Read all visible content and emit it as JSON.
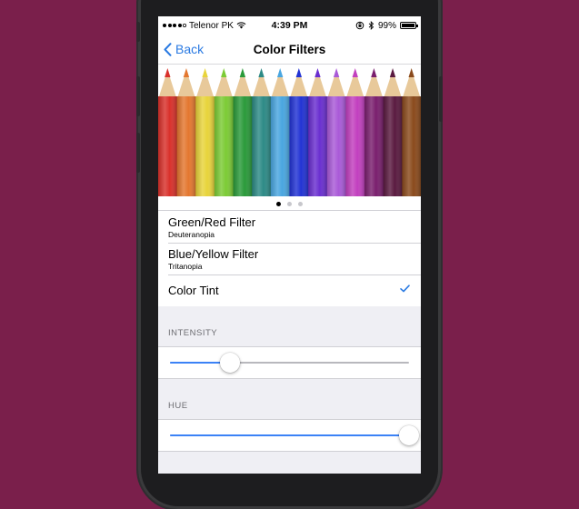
{
  "status_bar": {
    "carrier": "Telenor PK",
    "time": "4:39 PM",
    "battery": "99%",
    "signal_bars": 4
  },
  "nav": {
    "back_label": "Back",
    "title": "Color Filters"
  },
  "pencil_colors": [
    "#d9312b",
    "#e4772f",
    "#e8d43b",
    "#7ccb35",
    "#2a9a3a",
    "#2d8a86",
    "#4aa6e0",
    "#2233d4",
    "#6a2fd0",
    "#a95ad8",
    "#c23fbf",
    "#7a1f6e",
    "#5a1a40",
    "#8a4a1c"
  ],
  "page_control": {
    "count": 3,
    "current": 1
  },
  "filters": [
    {
      "title": "Green/Red Filter",
      "subtitle": "Deuteranopia",
      "checked": false
    },
    {
      "title": "Blue/Yellow Filter",
      "subtitle": "Tritanopia",
      "checked": false
    },
    {
      "title": "Color Tint",
      "subtitle": "",
      "checked": true
    }
  ],
  "intensity": {
    "header": "INTENSITY",
    "value": 0.25
  },
  "hue": {
    "header": "HUE",
    "value": 1.0
  },
  "colors": {
    "accent": "#2a7ae2",
    "background": "#7a1f4b"
  }
}
